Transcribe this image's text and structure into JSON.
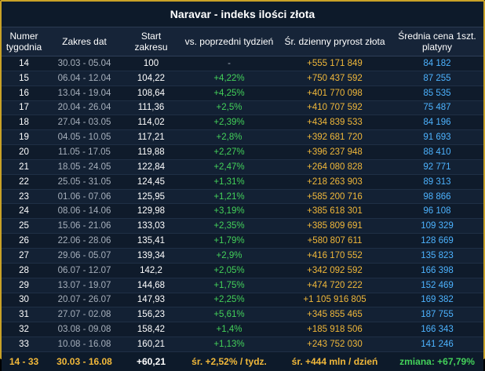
{
  "title": "Naravar - indeks ilości złota",
  "headers": {
    "week": "Numer tygodnia",
    "range": "Zakres dat",
    "start": "Start zakresu",
    "change": "vs. poprzedni tydzień",
    "growth": "Śr. dzienny pryrost złota",
    "price": "Średnia cena 1szt. platyny"
  },
  "rows": [
    {
      "week": "14",
      "range": "30.03 - 05.04",
      "start": "100",
      "change": "-",
      "growth": "+555 171 849",
      "price": "84 182"
    },
    {
      "week": "15",
      "range": "06.04 - 12.04",
      "start": "104,22",
      "change": "+4,22%",
      "growth": "+750 437 592",
      "price": "87 255"
    },
    {
      "week": "16",
      "range": "13.04 - 19.04",
      "start": "108,64",
      "change": "+4,25%",
      "growth": "+401 770 098",
      "price": "85 535"
    },
    {
      "week": "17",
      "range": "20.04 - 26.04",
      "start": "111,36",
      "change": "+2,5%",
      "growth": "+410 707 592",
      "price": "75 487"
    },
    {
      "week": "18",
      "range": "27.04 - 03.05",
      "start": "114,02",
      "change": "+2,39%",
      "growth": "+434 839 533",
      "price": "84 196"
    },
    {
      "week": "19",
      "range": "04.05 - 10.05",
      "start": "117,21",
      "change": "+2,8%",
      "growth": "+392 681 720",
      "price": "91 693"
    },
    {
      "week": "20",
      "range": "11.05 - 17.05",
      "start": "119,88",
      "change": "+2,27%",
      "growth": "+396 237 948",
      "price": "88 410"
    },
    {
      "week": "21",
      "range": "18.05 - 24.05",
      "start": "122,84",
      "change": "+2,47%",
      "growth": "+264 080 828",
      "price": "92 771"
    },
    {
      "week": "22",
      "range": "25.05 - 31.05",
      "start": "124,45",
      "change": "+1,31%",
      "growth": "+218 263 903",
      "price": "89 313"
    },
    {
      "week": "23",
      "range": "01.06 - 07.06",
      "start": "125,95",
      "change": "+1,21%",
      "growth": "+585 200 716",
      "price": "98 866"
    },
    {
      "week": "24",
      "range": "08.06 - 14.06",
      "start": "129,98",
      "change": "+3,19%",
      "growth": "+385 618 301",
      "price": "96 108"
    },
    {
      "week": "25",
      "range": "15.06 - 21.06",
      "start": "133,03",
      "change": "+2,35%",
      "growth": "+385 809 691",
      "price": "109 329"
    },
    {
      "week": "26",
      "range": "22.06 - 28.06",
      "start": "135,41",
      "change": "+1,79%",
      "growth": "+580 807 611",
      "price": "128 669"
    },
    {
      "week": "27",
      "range": "29.06 - 05.07",
      "start": "139,34",
      "change": "+2,9%",
      "growth": "+416 170 552",
      "price": "135 823"
    },
    {
      "week": "28",
      "range": "06.07 - 12.07",
      "start": "142,2",
      "change": "+2,05%",
      "growth": "+342 092 592",
      "price": "166 398"
    },
    {
      "week": "29",
      "range": "13.07 - 19.07",
      "start": "144,68",
      "change": "+1,75%",
      "growth": "+474 720 222",
      "price": "152 469"
    },
    {
      "week": "30",
      "range": "20.07 - 26.07",
      "start": "147,93",
      "change": "+2,25%",
      "growth": "+1 105 916 805",
      "price": "169 382"
    },
    {
      "week": "31",
      "range": "27.07 - 02.08",
      "start": "156,23",
      "change": "+5,61%",
      "growth": "+345 855 465",
      "price": "187 755"
    },
    {
      "week": "32",
      "range": "03.08 - 09.08",
      "start": "158,42",
      "change": "+1,4%",
      "growth": "+185 918 506",
      "price": "166 343"
    },
    {
      "week": "33",
      "range": "10.08 - 16.08",
      "start": "160,21",
      "change": "+1,13%",
      "growth": "+243 752 030",
      "price": "141 246"
    }
  ],
  "summary": {
    "week": "14 - 33",
    "range": "30.03 - 16.08",
    "start": "+60,21",
    "change": "śr. +2,52% / tydz.",
    "growth": "śr. +444 mln / dzień",
    "price": "zmiana: +67,79%"
  },
  "colors": {
    "border": "#c9a227",
    "background": "#101c2c",
    "positive": "#43d15a",
    "gold": "#f1b83a",
    "price": "#4db3ff"
  }
}
